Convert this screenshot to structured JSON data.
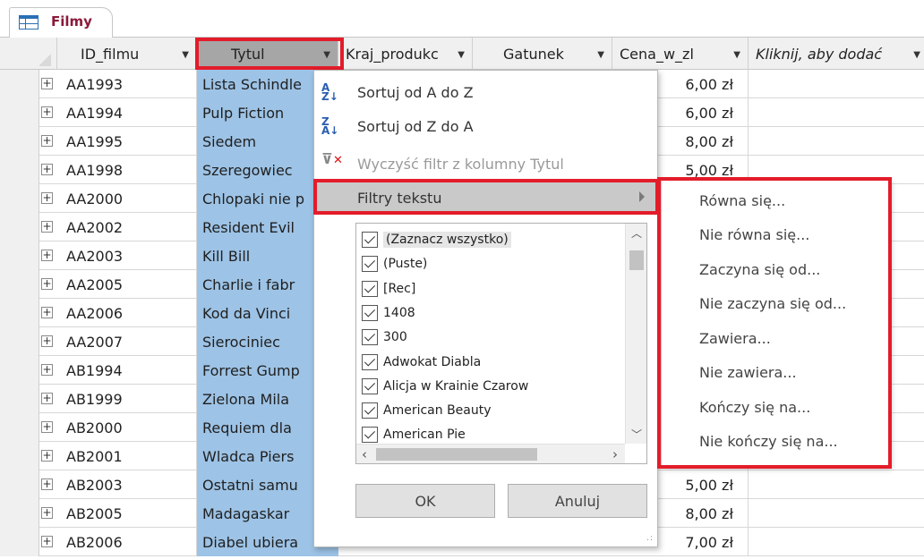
{
  "tab": {
    "title": "Filmy"
  },
  "columns": {
    "id": "ID_filmu",
    "tytul": "Tytul",
    "kraj": "Kraj_produkc",
    "gatunek": "Gatunek",
    "cena": "Cena_w_zl",
    "add": "Kliknij, aby dodać"
  },
  "rows": [
    {
      "id": "AA1993",
      "tytul": "Lista Schindle",
      "cena": "6,00 zł"
    },
    {
      "id": "AA1994",
      "tytul": "Pulp Fiction",
      "cena": "6,00 zł"
    },
    {
      "id": "AA1995",
      "tytul": "Siedem",
      "cena": "8,00 zł"
    },
    {
      "id": "AA1998",
      "tytul": "Szeregowiec",
      "cena": "5,00 zł"
    },
    {
      "id": "AA2000",
      "tytul": "Chlopaki nie p",
      "cena": ""
    },
    {
      "id": "AA2002",
      "tytul": "Resident Evil",
      "cena": ""
    },
    {
      "id": "AA2003",
      "tytul": "Kill Bill",
      "cena": ""
    },
    {
      "id": "AA2005",
      "tytul": "Charlie i fabr",
      "cena": ""
    },
    {
      "id": "AA2006",
      "tytul": "Kod da Vinci",
      "cena": ""
    },
    {
      "id": "AA2007",
      "tytul": "Sierociniec",
      "cena": ""
    },
    {
      "id": "AB1994",
      "tytul": "Forrest Gump",
      "cena": ""
    },
    {
      "id": "AB1999",
      "tytul": "Zielona Mila",
      "cena": ""
    },
    {
      "id": "AB2000",
      "tytul": "Requiem dla",
      "cena": ""
    },
    {
      "id": "AB2001",
      "tytul": "Wladca Piers",
      "cena": ""
    },
    {
      "id": "AB2003",
      "tytul": "Ostatni samu",
      "cena": "5,00 zł"
    },
    {
      "id": "AB2005",
      "tytul": "Madagaskar",
      "cena": "8,00 zł"
    },
    {
      "id": "AB2006",
      "tytul": "Diabel ubiera",
      "cena": "7,00 zł"
    }
  ],
  "menu": {
    "sort_az": "Sortuj od A do Z",
    "sort_za": "Sortuj od Z do A",
    "clear_filter": "Wyczyść filtr z kolumny Tytul",
    "text_filters": "Filtry tekstu"
  },
  "checklist": [
    "(Zaznacz wszystko)",
    "(Puste)",
    "[Rec]",
    "1408",
    "300",
    "Adwokat Diabla",
    "Alicja w Krainie Czarow",
    "American Beauty",
    "American Pie"
  ],
  "buttons": {
    "ok": "OK",
    "cancel": "Anuluj"
  },
  "submenu": [
    "Równa się...",
    "Nie równa się...",
    "Zaczyna się od...",
    "Nie zaczyna się od...",
    "Zawiera...",
    "Nie zawiera...",
    "Kończy się na...",
    "Nie kończy się na..."
  ]
}
